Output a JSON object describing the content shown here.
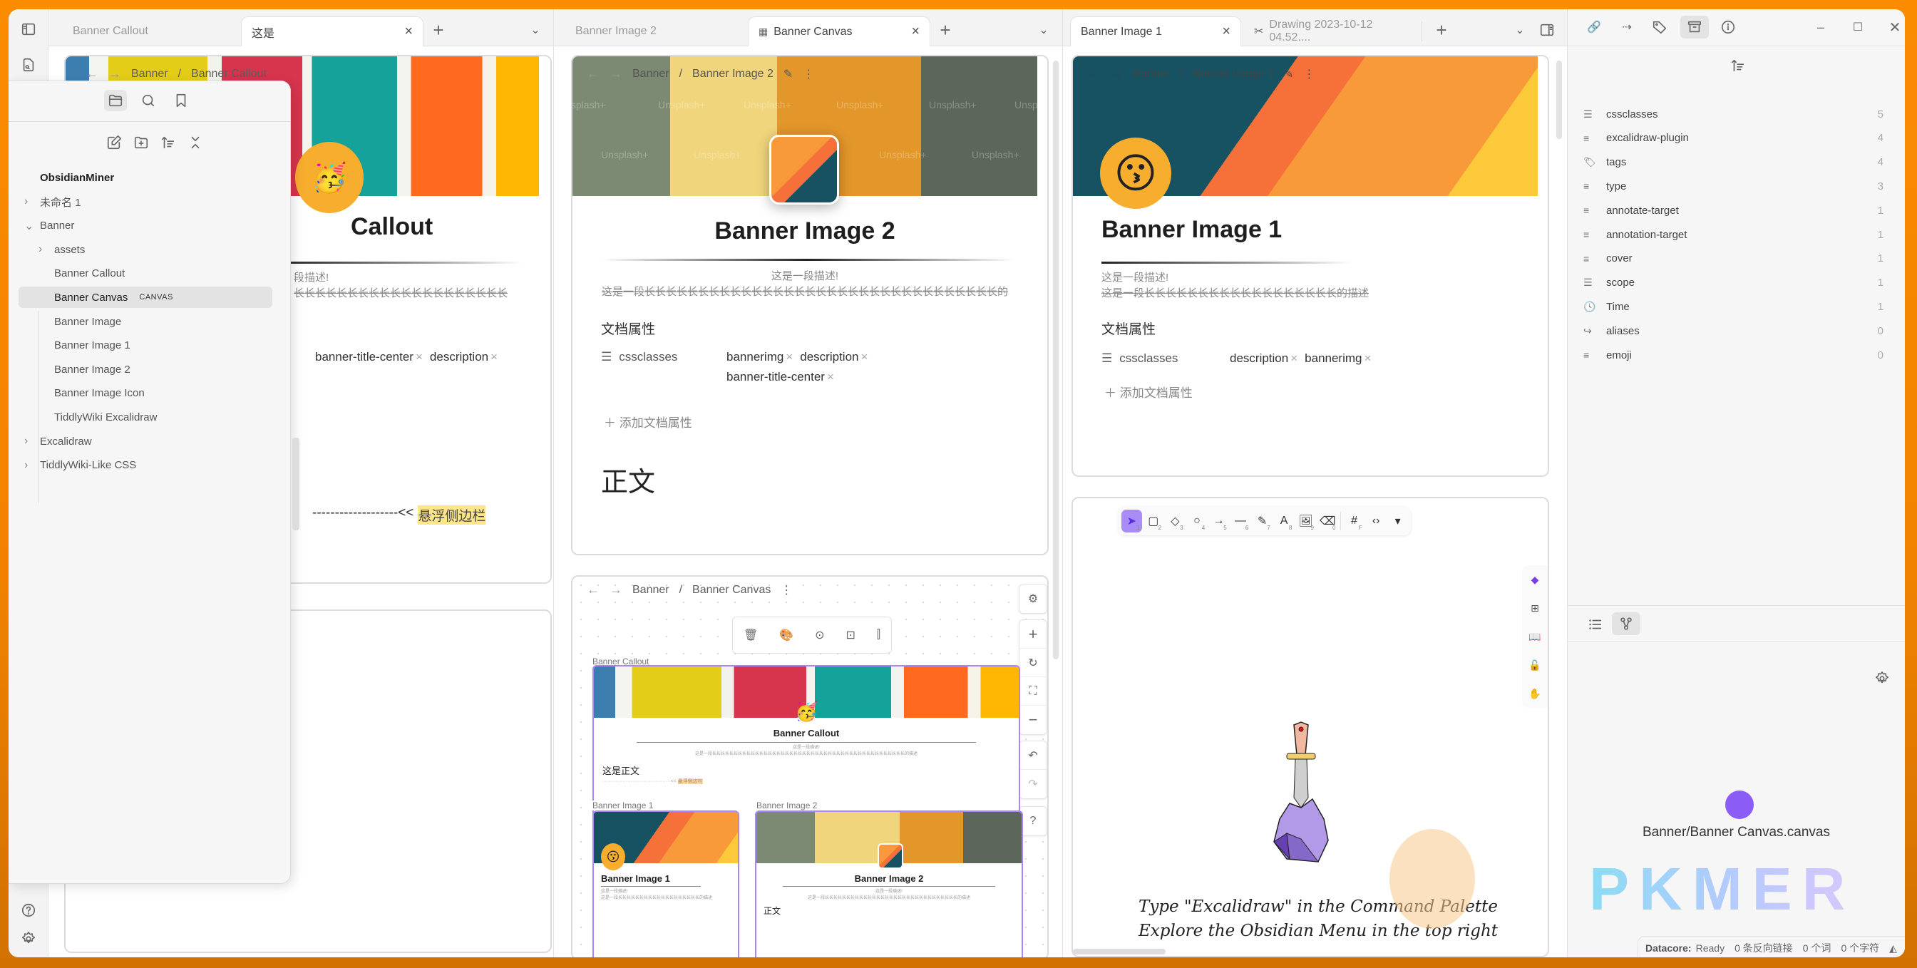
{
  "left_ribbon": {
    "icons": [
      "sidebar-toggle-icon",
      "file-search-icon",
      "help-icon",
      "settings-icon"
    ]
  },
  "panes": [
    {
      "tabs": [
        {
          "label": "Banner Callout",
          "active": false
        },
        {
          "label": "这是",
          "active": true
        }
      ],
      "note": {
        "breadcrumb": [
          "Banner",
          "Banner Callout"
        ],
        "title": "Banner Callout",
        "title_visible": "Callout",
        "desc_line1": "这是一段描述!",
        "desc_line1_visible": "段描述!",
        "desc_line2_visible": "长长长长长长长长长长长长长长长长长长长长",
        "chips": [
          "banner-title-center",
          "description"
        ],
        "hover_text_prefix": "-------------------<<",
        "hover_text": "悬浮侧边栏"
      }
    },
    {
      "tabs": [
        {
          "label": "Banner Image 2",
          "active": false
        },
        {
          "label": "Banner Canvas",
          "active": true
        }
      ],
      "note": {
        "breadcrumb": [
          "Banner",
          "Banner Image 2"
        ],
        "title": "Banner Image 2",
        "desc_line1": "这是一段描述!",
        "desc_line2": "这是一段长长长长长长长长长长长长长长长长长长长长长长长长长长长长长长长长长的",
        "props_heading": "文档属性",
        "prop_key": "cssclasses",
        "chips": [
          "bannerimg",
          "description",
          "banner-title-center"
        ],
        "add_prop": "添加文档属性",
        "body_heading": "正文",
        "watermark": "Unsplash+"
      },
      "canvas": {
        "breadcrumb": [
          "Banner",
          "Banner Canvas"
        ],
        "toolbar": [
          "trash-icon",
          "palette-icon",
          "zoom-to-selection-icon",
          "zoom-fit-icon",
          "align-icon"
        ],
        "controls": [
          "settings-icon",
          "zoom-in-icon",
          "reset-icon",
          "fit-icon",
          "zoom-out-icon",
          "undo-icon",
          "redo-icon",
          "help-icon"
        ],
        "nodes": [
          {
            "label": "Banner Callout",
            "title": "Banner Callout",
            "desc1": "这是一段描述!",
            "desc2": "这是一段长长长长长长长长长长长长长长长长长长长长长长长长长长长长长长长长长长长长长长长长长长长长长的描述",
            "body": "这是正文",
            "hover": "悬浮侧边栏"
          },
          {
            "label": "Banner Image 1",
            "title": "Banner Image 1",
            "desc1": "这是一段描述!",
            "desc2": "这是一段长长长长长长长长长长长长长长长长长长长的描述"
          },
          {
            "label": "Banner Image 2",
            "title": "Banner Image 2",
            "desc1": "这是一段描述!",
            "desc2": "这是一段长长长长长长长长长长长长长长长长长长长长长长长长长长长长长长长的描述",
            "body": "正文"
          }
        ]
      }
    },
    {
      "tabs": [
        {
          "label": "Banner Image 1",
          "active": true
        },
        {
          "label": "Drawing 2023-10-12 04.52....",
          "active": false
        }
      ],
      "note": {
        "breadcrumb": [
          "Banner",
          "Banner Image 1"
        ],
        "title": "Banner Image 1",
        "desc_line1": "这是一段描述!",
        "desc_line2": "这是一段长长长长长长长长长长长长长长长长长长的描述",
        "props_heading": "文档属性",
        "prop_key": "cssclasses",
        "chips": [
          "description",
          "bannerimg"
        ],
        "add_prop": "添加文档属性"
      },
      "excalidraw": {
        "tools": [
          {
            "icon": "selection-icon",
            "key": "1"
          },
          {
            "icon": "rectangle-icon",
            "key": "2"
          },
          {
            "icon": "diamond-icon",
            "key": "3"
          },
          {
            "icon": "ellipse-icon",
            "key": "4"
          },
          {
            "icon": "arrow-icon",
            "key": "5"
          },
          {
            "icon": "line-icon",
            "key": "6"
          },
          {
            "icon": "pencil-icon",
            "key": "7"
          },
          {
            "icon": "text-icon",
            "key": "8"
          },
          {
            "icon": "image-icon",
            "key": "9"
          },
          {
            "icon": "eraser-icon",
            "key": "0"
          },
          {
            "icon": "frame-icon",
            "key": "F"
          },
          {
            "icon": "embed-icon",
            "key": ""
          },
          {
            "icon": "more-tools-icon",
            "key": ""
          }
        ],
        "side_tools": [
          "obsidian-icon",
          "new-file-icon",
          "library-icon",
          "unlock-icon",
          "hand-icon"
        ],
        "text_line1": "Type \"Excalidraw\" in the Command Palette",
        "text_line2": "Explore the Obsidian Menu in the top right"
      }
    }
  ],
  "file_explorer": {
    "vault": "ObsidianMiner",
    "items": [
      {
        "label": "未命名 1",
        "type": "folder",
        "expanded": false,
        "depth": 0
      },
      {
        "label": "Banner",
        "type": "folder",
        "expanded": true,
        "depth": 0
      },
      {
        "label": "assets",
        "type": "folder",
        "expanded": false,
        "depth": 1
      },
      {
        "label": "Banner Callout",
        "type": "file",
        "depth": 1
      },
      {
        "label": "Banner Canvas",
        "type": "file",
        "depth": 1,
        "badge": "CANVAS",
        "active": true
      },
      {
        "label": "Banner Image",
        "type": "file",
        "depth": 1
      },
      {
        "label": "Banner Image 1",
        "type": "file",
        "depth": 1
      },
      {
        "label": "Banner Image 2",
        "type": "file",
        "depth": 1
      },
      {
        "label": "Banner Image Icon",
        "type": "file",
        "depth": 1
      },
      {
        "label": "TiddlyWiki Excalidraw",
        "type": "file",
        "depth": 1
      },
      {
        "label": "Excalidraw",
        "type": "folder",
        "expanded": false,
        "depth": 0
      },
      {
        "label": "TiddlyWiki-Like CSS",
        "type": "folder",
        "expanded": false,
        "depth": 0
      }
    ]
  },
  "right_sidebar": {
    "top_tabs": [
      "backlinks-icon",
      "outgoing-links-icon",
      "tags-icon",
      "all-properties-icon",
      "file-info-icon"
    ],
    "properties": [
      {
        "name": "cssclasses",
        "icon": "list",
        "count": "5"
      },
      {
        "name": "excalidraw-plugin",
        "icon": "text",
        "count": "4"
      },
      {
        "name": "tags",
        "icon": "tag",
        "count": "4"
      },
      {
        "name": "type",
        "icon": "text",
        "count": "3"
      },
      {
        "name": "annotate-target",
        "icon": "text",
        "count": "1"
      },
      {
        "name": "annotation-target",
        "icon": "text",
        "count": "1"
      },
      {
        "name": "cover",
        "icon": "text",
        "count": "1"
      },
      {
        "name": "scope",
        "icon": "list",
        "count": "1"
      },
      {
        "name": "Time",
        "icon": "clock",
        "count": "1"
      },
      {
        "name": "aliases",
        "icon": "alias",
        "count": "0"
      },
      {
        "name": "emoji",
        "icon": "text",
        "count": "0"
      }
    ],
    "graph_node_label": "Banner/Banner Canvas.canvas",
    "graph_node_color": "#8b5cf6",
    "watermark": "PKMER"
  },
  "status_bar": {
    "datacore_label": "Datacore:",
    "datacore_status": "Ready",
    "backlinks": "0 条反向链接",
    "words": "0 个词",
    "chars": "0 个字符"
  },
  "colors": {
    "accent": "#a882ff",
    "highlight": "#fde68a",
    "frame": "#fb8c00"
  }
}
